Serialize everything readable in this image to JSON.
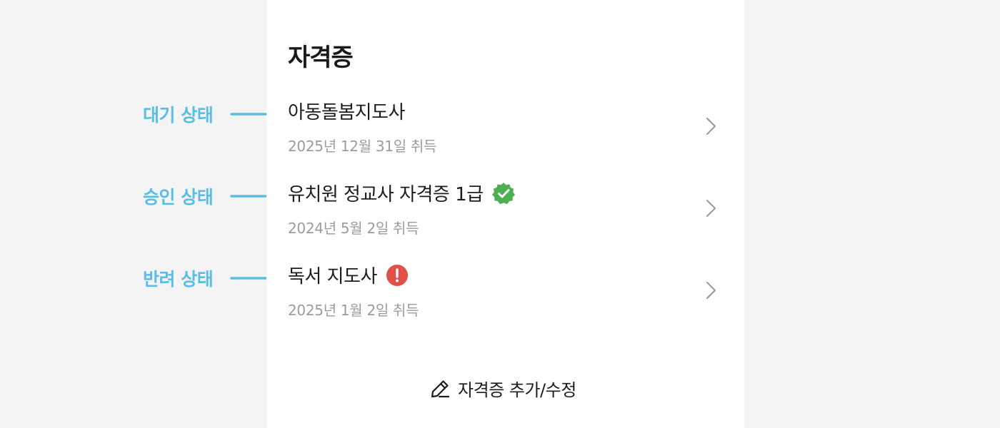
{
  "section": {
    "title": "자격증"
  },
  "certificates": [
    {
      "name": "아동돌봄지도사",
      "date": "2025년 12월 31일 취득",
      "status": "pending"
    },
    {
      "name": "유치원 정교사 자격증 1급",
      "date": "2024년 5월 2일 취득",
      "status": "approved"
    },
    {
      "name": "독서 지도사",
      "date": "2025년 1월 2일 취득",
      "status": "rejected"
    }
  ],
  "actions": {
    "edit_label": "자격증 추가/수정"
  },
  "annotations": [
    {
      "label": "대기 상태"
    },
    {
      "label": "승인 상태"
    },
    {
      "label": "반려 상태"
    }
  ],
  "colors": {
    "annotation": "#5bbde4",
    "approved": "#4caf50",
    "rejected": "#e05046",
    "chevron": "#999999"
  },
  "icons": {
    "approved": "verified-check-icon",
    "rejected": "exclamation-icon",
    "chevron": "chevron-right-icon",
    "edit": "pencil-icon",
    "arrow": "arrow-right-icon"
  }
}
